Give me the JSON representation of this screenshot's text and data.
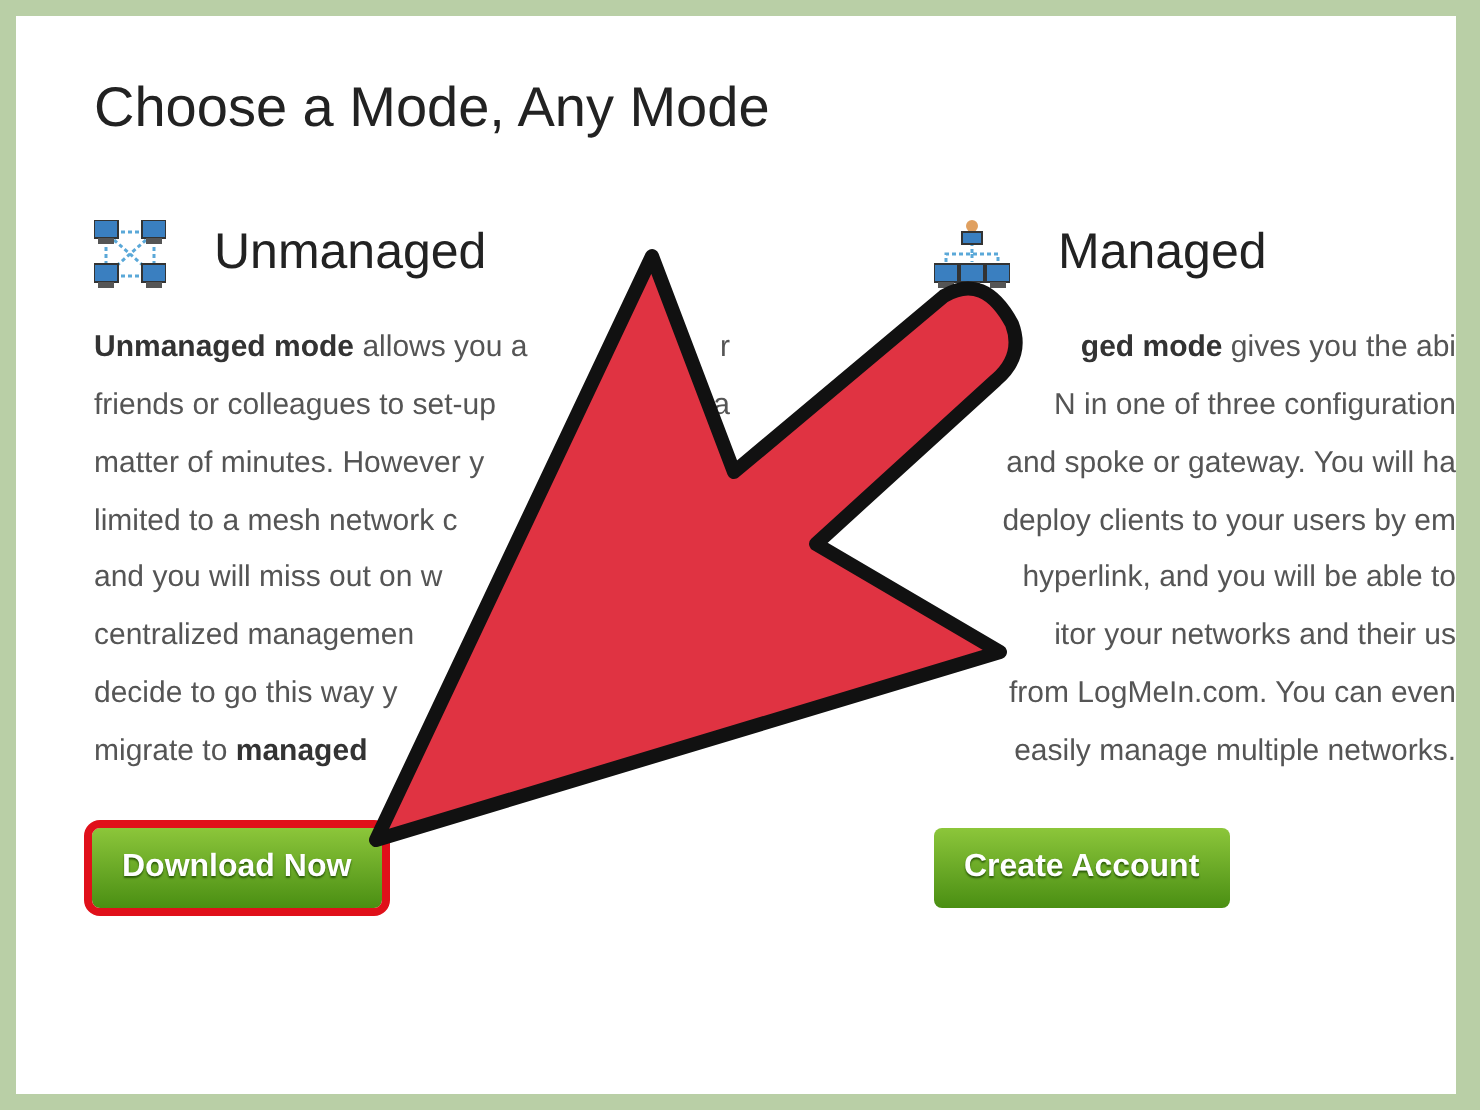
{
  "page": {
    "title": "Choose a Mode, Any Mode"
  },
  "modes": [
    {
      "heading": "Unmanaged",
      "kind": "mesh",
      "lines": [
        {
          "text": "**Unmanaged mode** allows you a",
          "tail": "r"
        },
        {
          "text": "friends or colleagues to set-up",
          "tail": "a"
        },
        {
          "text": "matter of minutes. However y"
        },
        {
          "text": "limited to a mesh network c"
        },
        {
          "text": "and you will miss out on w"
        },
        {
          "text": "centralized managemen"
        },
        {
          "text": "decide to go this way y"
        },
        {
          "text": "migrate to **managed**"
        }
      ],
      "button": {
        "label": "Download Now",
        "highlighted": true
      }
    },
    {
      "heading": "Managed",
      "kind": "hub",
      "lines": [
        {
          "text": "**ged mode** gives you the abi"
        },
        {
          "text": "N in one of three configuration"
        },
        {
          "text": "and spoke or gateway. You will ha"
        },
        {
          "text": "deploy clients to your users by em"
        },
        {
          "text": "hyperlink, and you will be able to"
        },
        {
          "text": "itor your networks and their us"
        },
        {
          "text": "from LogMeIn.com. You can even"
        },
        {
          "text": "easily manage multiple networks."
        }
      ],
      "button": {
        "label": "Create Account",
        "highlighted": false
      }
    }
  ],
  "overlay": {
    "kind": "arrow"
  }
}
